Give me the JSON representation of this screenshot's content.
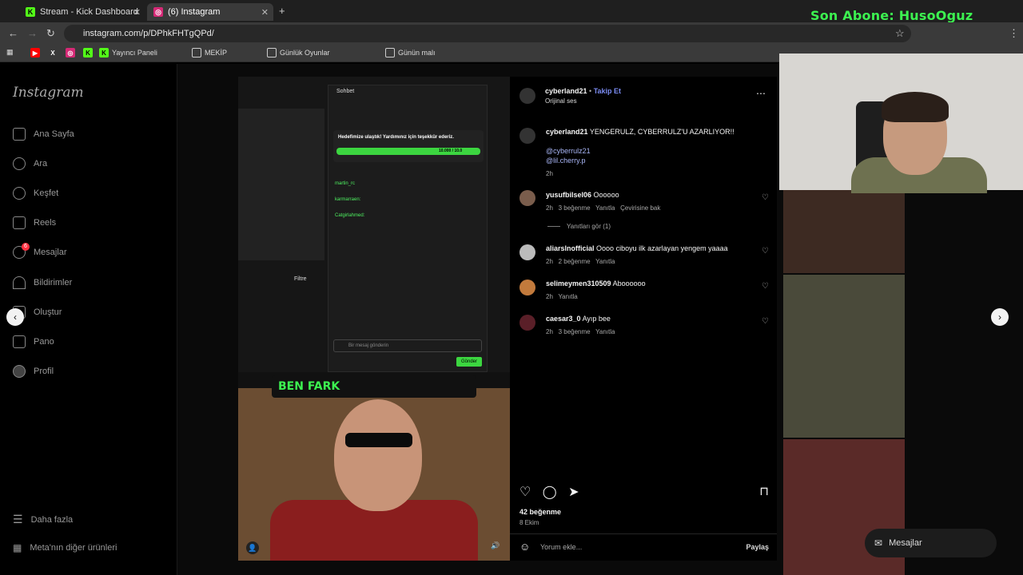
{
  "browser": {
    "tabs": [
      {
        "label": "Stream - Kick Dashboard"
      },
      {
        "label": "(6) Instagram"
      }
    ],
    "url": "instagram.com/p/DPhkFHTgQPd/",
    "bookmarks": [
      {
        "label": "Yayıncı Paneli"
      },
      {
        "label": "MEKİP"
      },
      {
        "label": "Günlük Oyunlar"
      },
      {
        "label": "Günün malı"
      }
    ]
  },
  "overlay": {
    "subscriber": "Son Abone: HusoOguz",
    "ben_fark": "BEN FARK",
    "chat_header": "Sohbet",
    "goal_text": "Hedefimize ulaştık! Yardımınız için teşekkür ederiz.",
    "goal_value": "10.000 / 10.0",
    "chat_input": "Bir mesaj gönderin",
    "send": "Gönder",
    "filter": "Filtre"
  },
  "sidebar": {
    "logo": "Instagram",
    "items": [
      {
        "label": "Ana Sayfa"
      },
      {
        "label": "Ara"
      },
      {
        "label": "Keşfet"
      },
      {
        "label": "Reels"
      },
      {
        "label": "Mesajlar"
      },
      {
        "label": "Bildirimler"
      },
      {
        "label": "Oluştur"
      },
      {
        "label": "Pano"
      },
      {
        "label": "Profil"
      }
    ],
    "more": "Daha fazla",
    "meta": "Meta'nın diğer ürünleri",
    "messages_badge": "6"
  },
  "post": {
    "author": "cyberland21",
    "follow": "Takip Et",
    "audio": "Orijinal ses",
    "caption": "YENGERULZ, CYBERRULZ'U AZARLIYOR!!",
    "mention1": "@cyberrulz21",
    "mention2": "@lil.cherry.p",
    "caption_time": "2h",
    "comments": [
      {
        "user": "yusufbilsel06",
        "text": "Oooooo",
        "time": "2h",
        "likes": "3 beğenme",
        "reply": "Yanıtla",
        "translate": "Çevirisine bak"
      },
      {
        "user": "aliarslnofficial",
        "text": "Oooo ciboyu ilk azarlayan yengem yaaaa",
        "time": "2h",
        "likes": "2 beğenme",
        "reply": "Yanıtla"
      },
      {
        "user": "selimeymen310509",
        "text": "Aboooooo",
        "time": "2h",
        "reply": "Yanıtla"
      },
      {
        "user": "caesar3_0",
        "text": "Ayıp bee",
        "time": "2h",
        "likes": "3 beğenme",
        "reply": "Yanıtla"
      }
    ],
    "view_replies": "Yanıtları gör (1)",
    "like_count": "42 beğenme",
    "date": "8 Ekim",
    "comment_placeholder": "Yorum ekle...",
    "share": "Paylaş"
  },
  "messages_pill": "Mesajlar"
}
